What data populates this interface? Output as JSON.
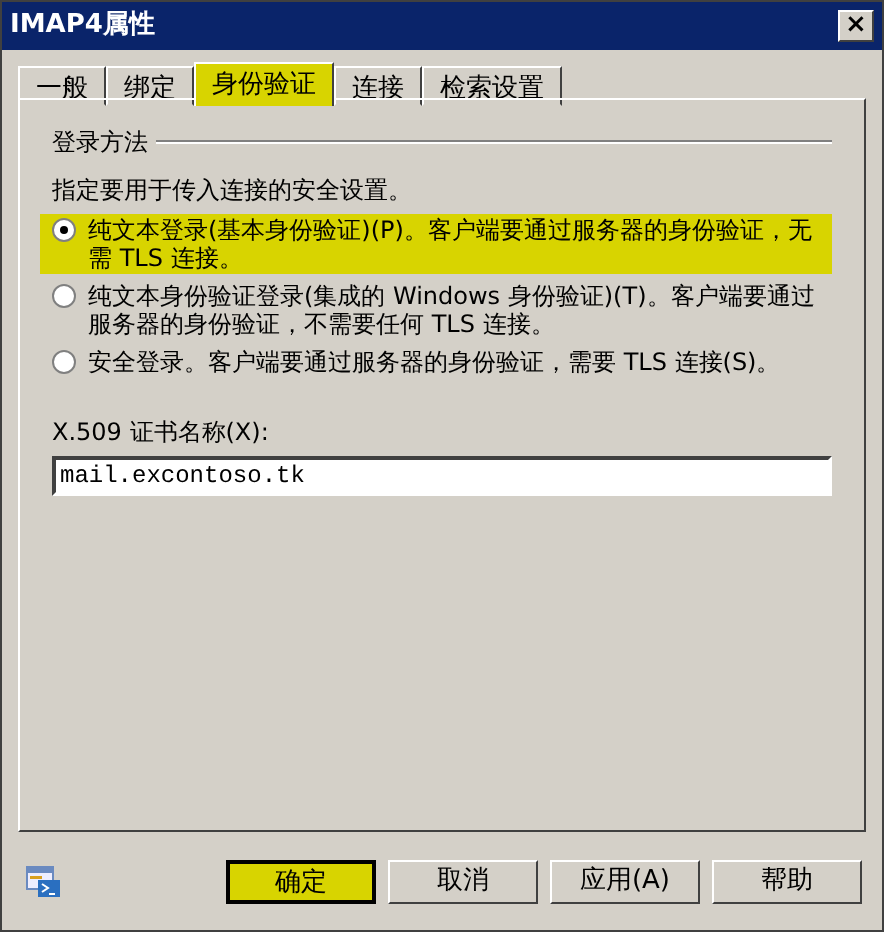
{
  "window": {
    "title": "IMAP4属性",
    "close": "×"
  },
  "tabs": [
    {
      "label": "一般",
      "selected": false,
      "highlighted": false
    },
    {
      "label": "绑定",
      "selected": false,
      "highlighted": false
    },
    {
      "label": "身份验证",
      "selected": true,
      "highlighted": true
    },
    {
      "label": "连接",
      "selected": false,
      "highlighted": false
    },
    {
      "label": "检索设置",
      "selected": false,
      "highlighted": false
    }
  ],
  "group": {
    "title": "登录方法",
    "description": "指定要用于传入连接的安全设置。",
    "options": [
      {
        "label": "纯文本登录(基本身份验证)(P)。客户端要通过服务器的身份验证，无需 TLS 连接。",
        "selected": true,
        "highlighted": true
      },
      {
        "label": "纯文本身份验证登录(集成的 Windows 身份验证)(T)。客户端要通过服务器的身份验证，不需要任何 TLS 连接。",
        "selected": false,
        "highlighted": false
      },
      {
        "label": "安全登录。客户端要通过服务器的身份验证，需要 TLS 连接(S)。",
        "selected": false,
        "highlighted": false
      }
    ]
  },
  "certificate": {
    "label": "X.509 证书名称(X):",
    "value": "mail.excontoso.tk"
  },
  "buttons": [
    {
      "label": "确定",
      "highlighted": true
    },
    {
      "label": "取消",
      "highlighted": false
    },
    {
      "label": "应用(A)",
      "highlighted": false
    },
    {
      "label": "帮助",
      "highlighted": false
    }
  ]
}
